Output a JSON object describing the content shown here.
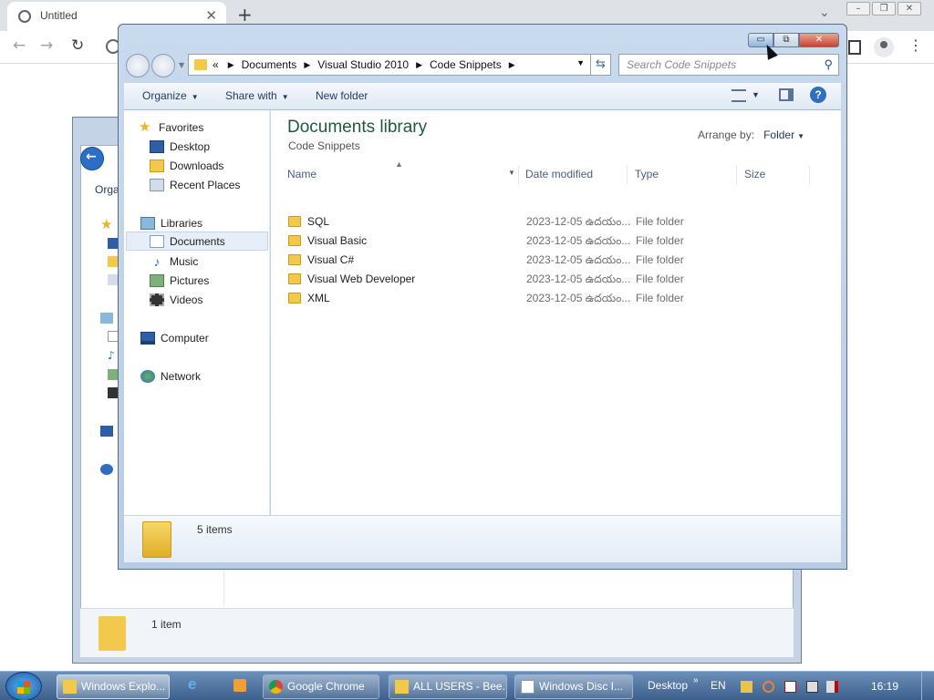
{
  "chrome": {
    "tab_title": "Untitled",
    "tab_close": "✕",
    "new_tab": "+",
    "expand": "⌄",
    "window_buttons": [
      "–",
      "❐",
      "✕"
    ],
    "back": "←",
    "forward": "→",
    "reload": "↻",
    "menu": "⋮"
  },
  "bg_explorer": {
    "organize_fragment": "Orga",
    "status_count": "1 item"
  },
  "explorer": {
    "caption": {
      "minimize": "▭",
      "maximize": "⧉",
      "close": "✕"
    },
    "breadcrumb": {
      "overflow": "«",
      "items": [
        "Documents",
        "Visual Studio 2010",
        "Code Snippets"
      ]
    },
    "refresh": "⇆",
    "search_placeholder": "Search Code Snippets",
    "search_icon": "⚲",
    "commands": {
      "organize": "Organize",
      "share_with": "Share with",
      "new_folder": "New folder",
      "help": "?"
    },
    "nav": {
      "favorites": "Favorites",
      "desktop": "Desktop",
      "downloads": "Downloads",
      "recent_places": "Recent Places",
      "libraries": "Libraries",
      "documents": "Documents",
      "music": "Music",
      "pictures": "Pictures",
      "videos": "Videos",
      "computer": "Computer",
      "network": "Network"
    },
    "library": {
      "title": "Documents library",
      "subtitle": "Code Snippets",
      "arrange_label": "Arrange by:",
      "arrange_value": "Folder"
    },
    "columns": {
      "name": "Name",
      "date_modified": "Date modified",
      "type": "Type",
      "size": "Size"
    },
    "files": [
      {
        "name": "SQL",
        "date": "2023-12-05 ఉదయం...",
        "type": "File folder"
      },
      {
        "name": "Visual Basic",
        "date": "2023-12-05 ఉదయం...",
        "type": "File folder"
      },
      {
        "name": "Visual C#",
        "date": "2023-12-05 ఉదయం...",
        "type": "File folder"
      },
      {
        "name": "Visual Web Developer",
        "date": "2023-12-05 ఉదయం...",
        "type": "File folder"
      },
      {
        "name": "XML",
        "date": "2023-12-05 ఉదయం...",
        "type": "File folder"
      }
    ],
    "status_count": "5 items"
  },
  "taskbar": {
    "buttons": [
      "Windows Explo...",
      "Google Chrome",
      "ALL USERS - Bee...",
      "Windows Disc I..."
    ],
    "desktop_toolbar": "Desktop",
    "chevron": "»",
    "language": "EN",
    "time": "16:19"
  },
  "colors": {
    "library_title": "#1e5a3c",
    "accent": "#2f6fbf",
    "taskbar": "#4a6e9c"
  }
}
